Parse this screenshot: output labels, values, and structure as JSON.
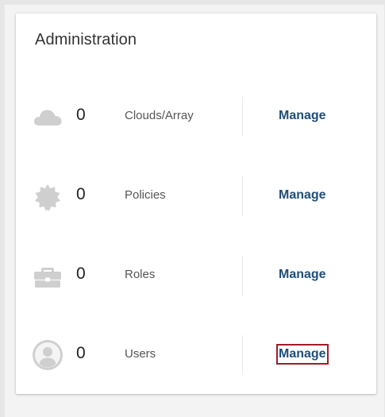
{
  "panel": {
    "title": "Administration"
  },
  "rows": [
    {
      "icon": "cloud-icon",
      "count": "0",
      "label": "Clouds/Array",
      "action": "Manage"
    },
    {
      "icon": "policy-badge-icon",
      "count": "0",
      "label": "Policies",
      "action": "Manage"
    },
    {
      "icon": "briefcase-icon",
      "count": "0",
      "label": "Roles",
      "action": "Manage"
    },
    {
      "icon": "user-circle-icon",
      "count": "0",
      "label": "Users",
      "action": "Manage"
    }
  ],
  "colors": {
    "icon": "#cfcfcf",
    "link": "#1f4e79",
    "highlight_border": "#a31c2a"
  }
}
